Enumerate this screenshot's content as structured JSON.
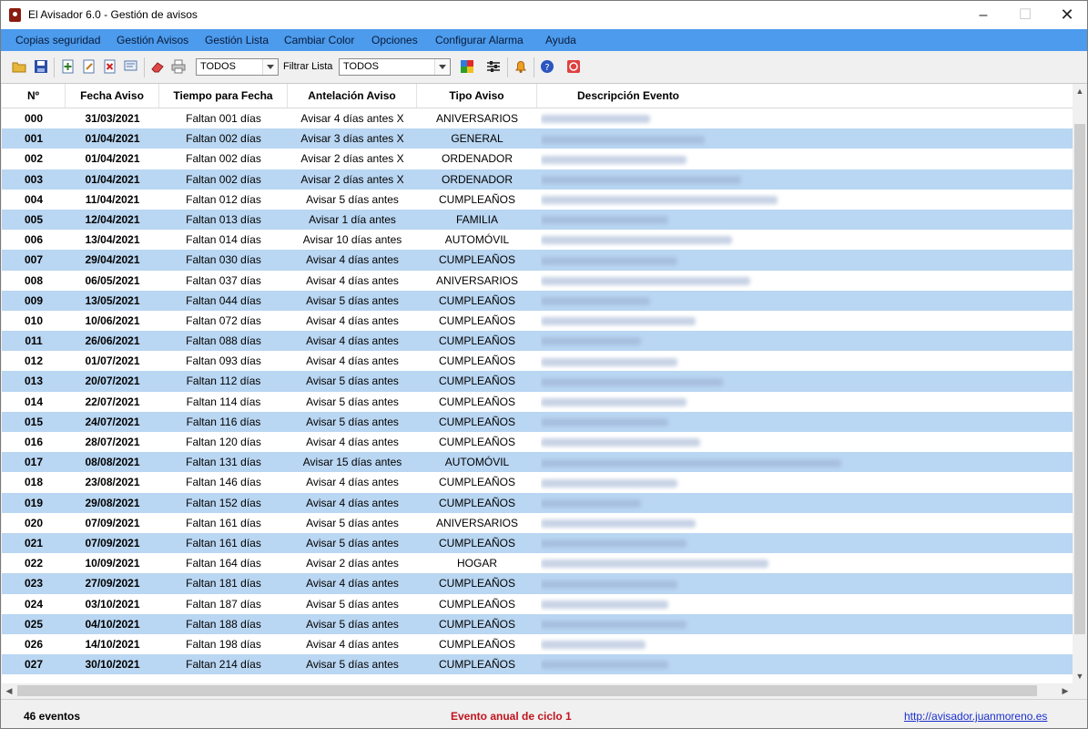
{
  "window": {
    "title": "El Avisador 6.0 - Gestión de avisos"
  },
  "menu": [
    "Copias seguridad",
    "Gestión Avisos",
    "Gestión Lista",
    "Cambiar Color",
    "Opciones",
    "Configurar  Alarma",
    "Ayuda"
  ],
  "toolbar": {
    "select1_value": "TODOS",
    "filter_label": "Filtrar Lista",
    "select2_value": "TODOS",
    "icons": [
      "open-folder-icon",
      "save-icon",
      "add-icon",
      "edit-icon",
      "delete-icon",
      "note-icon",
      "eraser-icon",
      "print-icon",
      "color-palette-icon",
      "settings-sliders-icon",
      "alarm-bell-icon",
      "help-icon",
      "exit-icon"
    ]
  },
  "table": {
    "headers": [
      "Nº",
      "Fecha Aviso",
      "Tiempo para Fecha",
      "Antelación Aviso",
      "Tipo Aviso",
      "Descripción Evento"
    ],
    "rows": [
      {
        "n": "000",
        "date": "31/03/2021",
        "time": "Faltan 001 días",
        "ant": "Avisar 4 días antes  X",
        "tipo": "ANIVERSARIOS"
      },
      {
        "n": "001",
        "date": "01/04/2021",
        "time": "Faltan 002 días",
        "ant": "Avisar 3 días antes  X",
        "tipo": "GENERAL"
      },
      {
        "n": "002",
        "date": "01/04/2021",
        "time": "Faltan 002 días",
        "ant": "Avisar 2 días antes  X",
        "tipo": "ORDENADOR"
      },
      {
        "n": "003",
        "date": "01/04/2021",
        "time": "Faltan 002 días",
        "ant": "Avisar 2 días antes  X",
        "tipo": "ORDENADOR"
      },
      {
        "n": "004",
        "date": "11/04/2021",
        "time": "Faltan 012 días",
        "ant": "Avisar 5 días antes",
        "tipo": "CUMPLEAÑOS"
      },
      {
        "n": "005",
        "date": "12/04/2021",
        "time": "Faltan 013 días",
        "ant": "Avisar 1 día antes",
        "tipo": "FAMILIA"
      },
      {
        "n": "006",
        "date": "13/04/2021",
        "time": "Faltan 014 días",
        "ant": "Avisar 10 días antes",
        "tipo": "AUTOMÓVIL"
      },
      {
        "n": "007",
        "date": "29/04/2021",
        "time": "Faltan 030 días",
        "ant": "Avisar 4 días antes",
        "tipo": "CUMPLEAÑOS"
      },
      {
        "n": "008",
        "date": "06/05/2021",
        "time": "Faltan 037 días",
        "ant": "Avisar 4 días antes",
        "tipo": "ANIVERSARIOS"
      },
      {
        "n": "009",
        "date": "13/05/2021",
        "time": "Faltan 044 días",
        "ant": "Avisar 5 días antes",
        "tipo": "CUMPLEAÑOS"
      },
      {
        "n": "010",
        "date": "10/06/2021",
        "time": "Faltan 072 días",
        "ant": "Avisar 4 días antes",
        "tipo": "CUMPLEAÑOS"
      },
      {
        "n": "011",
        "date": "26/06/2021",
        "time": "Faltan 088 días",
        "ant": "Avisar 4 días antes",
        "tipo": "CUMPLEAÑOS"
      },
      {
        "n": "012",
        "date": "01/07/2021",
        "time": "Faltan 093 días",
        "ant": "Avisar 4 días antes",
        "tipo": "CUMPLEAÑOS"
      },
      {
        "n": "013",
        "date": "20/07/2021",
        "time": "Faltan 112 días",
        "ant": "Avisar 5 días antes",
        "tipo": "CUMPLEAÑOS"
      },
      {
        "n": "014",
        "date": "22/07/2021",
        "time": "Faltan 114 días",
        "ant": "Avisar 5 días antes",
        "tipo": "CUMPLEAÑOS"
      },
      {
        "n": "015",
        "date": "24/07/2021",
        "time": "Faltan 116 días",
        "ant": "Avisar 5 días antes",
        "tipo": "CUMPLEAÑOS"
      },
      {
        "n": "016",
        "date": "28/07/2021",
        "time": "Faltan 120 días",
        "ant": "Avisar 4 días antes",
        "tipo": "CUMPLEAÑOS"
      },
      {
        "n": "017",
        "date": "08/08/2021",
        "time": "Faltan 131 días",
        "ant": "Avisar 15 días antes",
        "tipo": "AUTOMÓVIL"
      },
      {
        "n": "018",
        "date": "23/08/2021",
        "time": "Faltan 146 días",
        "ant": "Avisar 4 días antes",
        "tipo": "CUMPLEAÑOS"
      },
      {
        "n": "019",
        "date": "29/08/2021",
        "time": "Faltan 152 días",
        "ant": "Avisar 4 días antes",
        "tipo": "CUMPLEAÑOS"
      },
      {
        "n": "020",
        "date": "07/09/2021",
        "time": "Faltan 161 días",
        "ant": "Avisar 5 días antes",
        "tipo": "ANIVERSARIOS"
      },
      {
        "n": "021",
        "date": "07/09/2021",
        "time": "Faltan 161 días",
        "ant": "Avisar 5 días antes",
        "tipo": "CUMPLEAÑOS"
      },
      {
        "n": "022",
        "date": "10/09/2021",
        "time": "Faltan 164 días",
        "ant": "Avisar 2 días antes",
        "tipo": "HOGAR"
      },
      {
        "n": "023",
        "date": "27/09/2021",
        "time": "Faltan 181 días",
        "ant": "Avisar 4 días antes",
        "tipo": "CUMPLEAÑOS"
      },
      {
        "n": "024",
        "date": "03/10/2021",
        "time": "Faltan 187 días",
        "ant": "Avisar 5 días antes",
        "tipo": "CUMPLEAÑOS"
      },
      {
        "n": "025",
        "date": "04/10/2021",
        "time": "Faltan 188 días",
        "ant": "Avisar 5 días antes",
        "tipo": "CUMPLEAÑOS"
      },
      {
        "n": "026",
        "date": "14/10/2021",
        "time": "Faltan 198 días",
        "ant": "Avisar 4 días antes",
        "tipo": "CUMPLEAÑOS"
      },
      {
        "n": "027",
        "date": "30/10/2021",
        "time": "Faltan 214 días",
        "ant": "Avisar 5 días antes",
        "tipo": "CUMPLEAÑOS"
      }
    ]
  },
  "status": {
    "count": "46 eventos",
    "event": "Evento  anual de ciclo 1",
    "link": "http://avisador.juanmoreno.es"
  },
  "colors": {
    "menu_bg": "#4c9bec",
    "alt_row": "#b9d6f2",
    "event_red": "#c0141e",
    "link_blue": "#1a2fd0"
  }
}
